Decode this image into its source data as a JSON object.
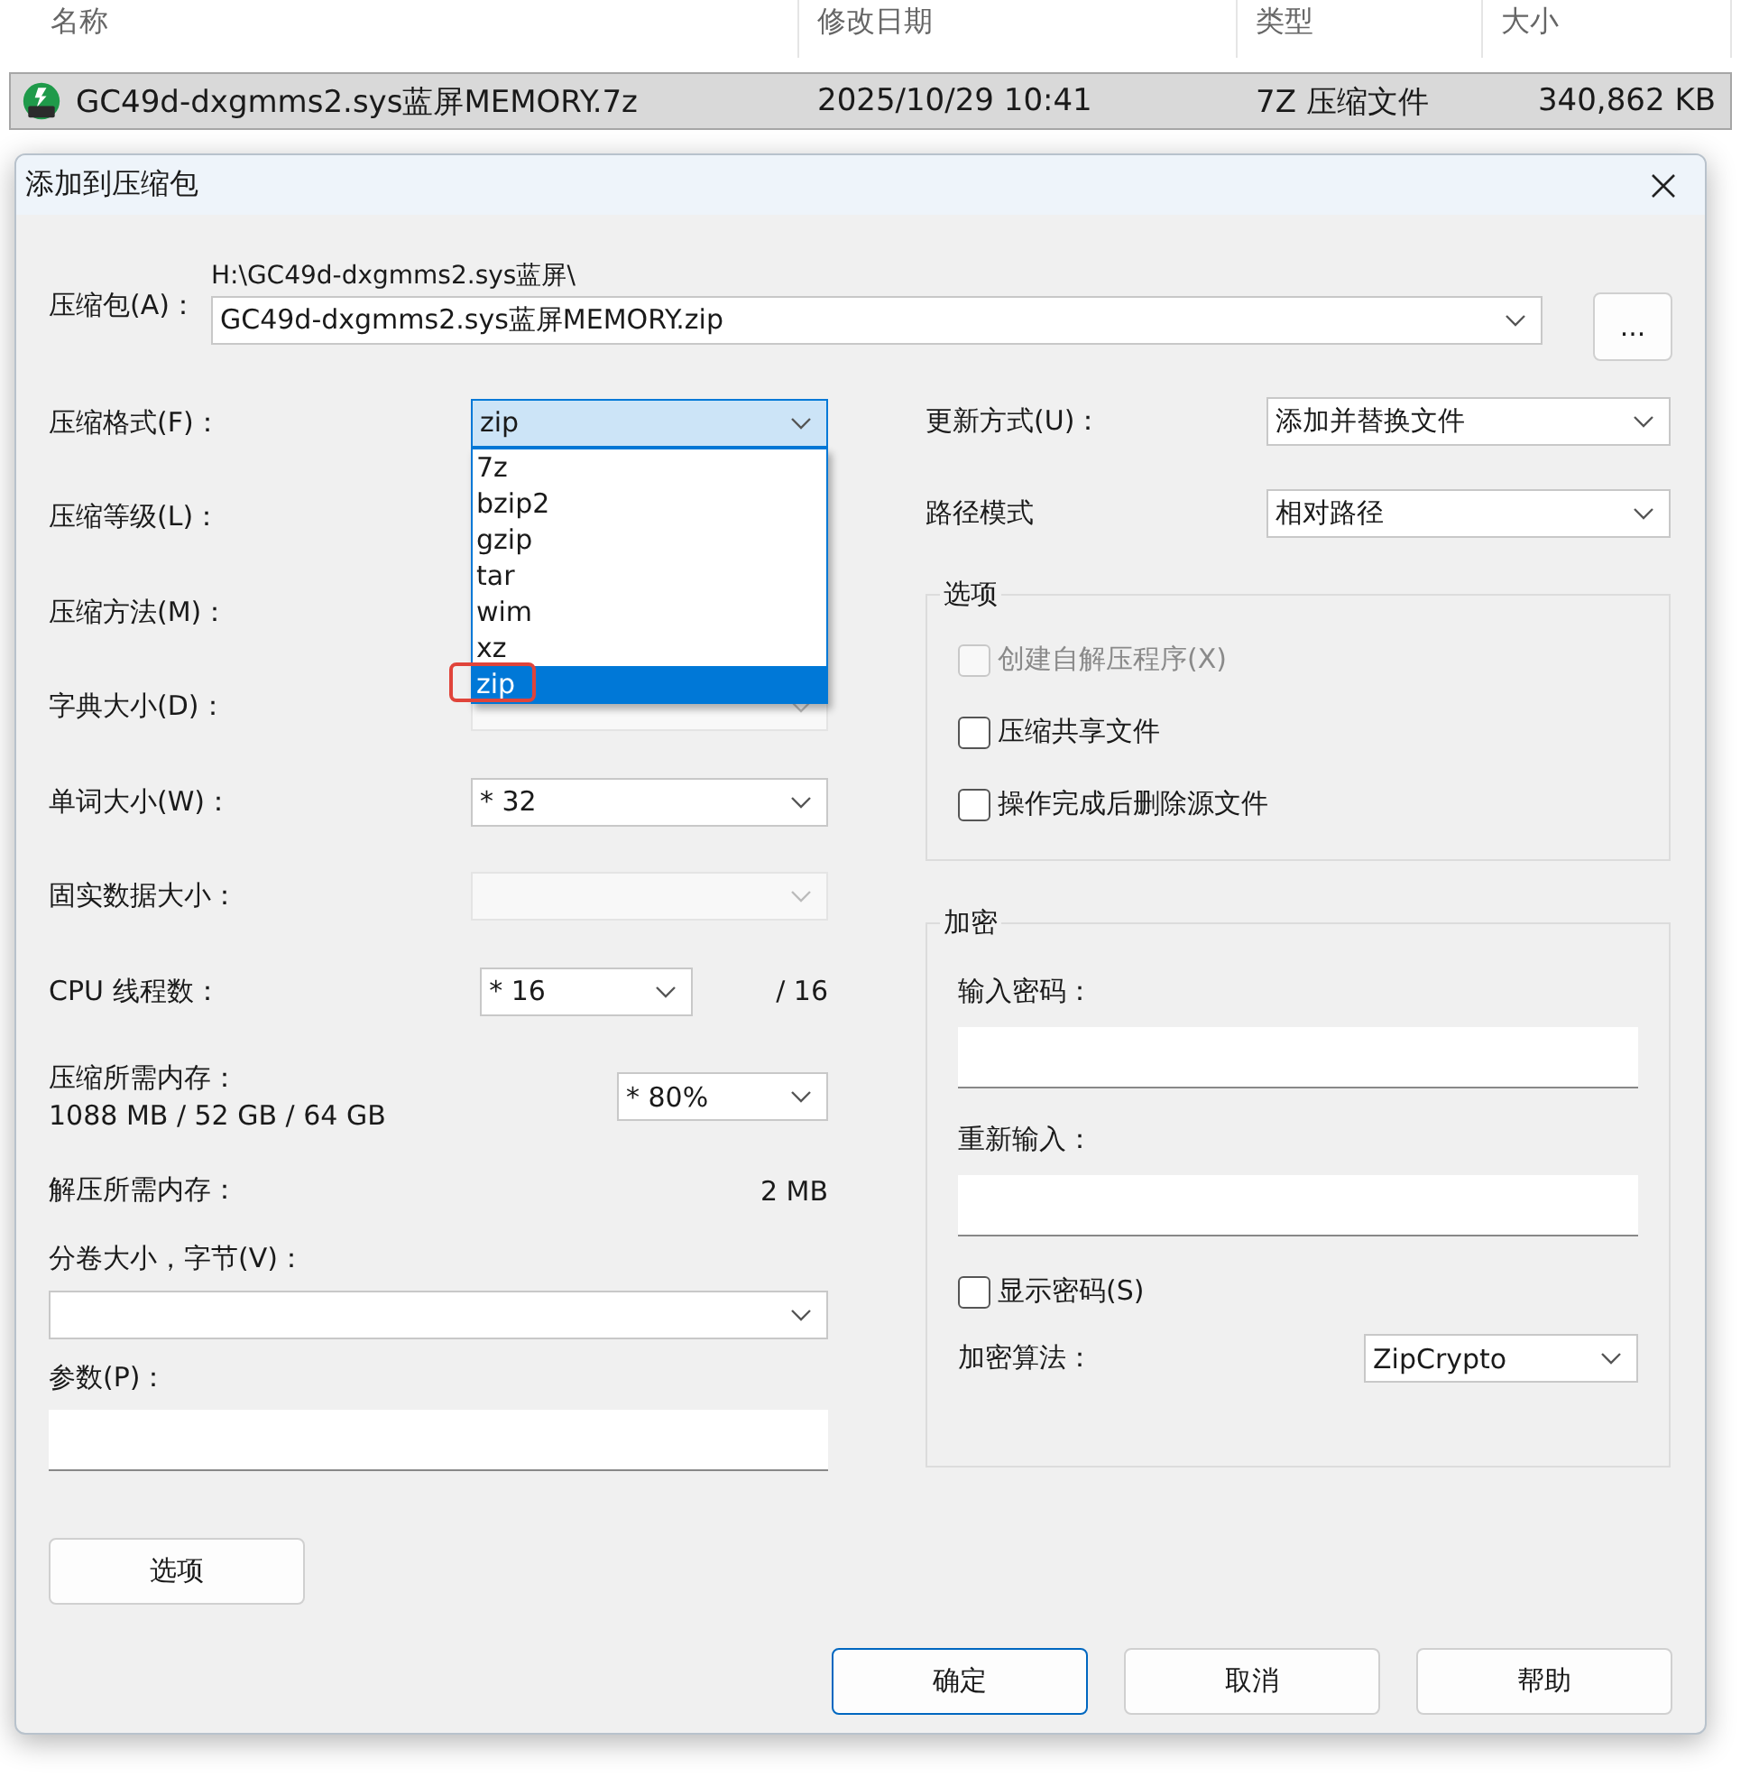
{
  "file_list": {
    "columns": [
      "名称",
      "修改日期",
      "类型",
      "大小"
    ],
    "rows": [
      {
        "name": "GC49d-dxgmms2.sys蓝屏MEMORY.7z",
        "modified": "2025/10/29 10:41",
        "type": "7Z 压缩文件",
        "size": "340,862 KB",
        "selected": true
      }
    ]
  },
  "dialog": {
    "title": "添加到压缩包",
    "archive": {
      "label": "压缩包(A)：",
      "path": "H:\\GC49d-dxgmms2.sys蓝屏\\",
      "value": "GC49d-dxgmms2.sys蓝屏MEMORY.zip",
      "browse": "..."
    },
    "left_rows": [
      {
        "kind": "combo",
        "label": "压缩格式(F)：",
        "value": "zip",
        "disabled": false,
        "expanded": true,
        "options": [
          {
            "label": "7z",
            "selected": false
          },
          {
            "label": "bzip2",
            "selected": false
          },
          {
            "label": "gzip",
            "selected": false
          },
          {
            "label": "tar",
            "selected": false
          },
          {
            "label": "wim",
            "selected": false
          },
          {
            "label": "xz",
            "selected": false
          },
          {
            "label": "zip",
            "selected": true,
            "annotated": true
          }
        ]
      },
      {
        "kind": "label",
        "label": "压缩等级(L)："
      },
      {
        "kind": "label",
        "label": "压缩方法(M)："
      },
      {
        "kind": "combo",
        "label": "字典大小(D)：",
        "disabled": true,
        "expanded": false
      },
      {
        "kind": "combo",
        "label": "单词大小(W)：",
        "value": "* 32",
        "disabled": false,
        "expanded": false
      },
      {
        "kind": "combo",
        "label": "固实数据大小：",
        "disabled": true,
        "expanded": false
      },
      {
        "kind": "count",
        "label": "CPU 线程数：",
        "value": "* 16",
        "total": "/ 16"
      },
      {
        "kind": "memory",
        "label": "压缩所需内存：",
        "detail": "1088 MB / 52 GB / 64 GB",
        "value": "* 80%"
      },
      {
        "kind": "info",
        "label": "解压所需内存：",
        "value": "2 MB"
      },
      {
        "kind": "stacked_combo",
        "label": "分卷大小，字节(V)："
      },
      {
        "kind": "stacked_field",
        "label": "参数(P)："
      }
    ],
    "options_button": "选项",
    "update": {
      "label": "更新方式(U)：",
      "value": "添加并替换文件"
    },
    "path_mode": {
      "label": "路径模式",
      "value": "相对路径"
    },
    "options_group": {
      "title": "选项",
      "checkboxes": [
        {
          "label": "创建自解压程序(X)",
          "checked": false,
          "disabled": true
        },
        {
          "label": "压缩共享文件",
          "checked": false,
          "disabled": false
        },
        {
          "label": "操作完成后删除源文件",
          "checked": false,
          "disabled": false
        }
      ]
    },
    "encryption": {
      "title": "加密",
      "password_label": "输入密码：",
      "repeat_label": "重新输入：",
      "show_password": {
        "label": "显示密码(S)",
        "checked": false
      },
      "method_label": "加密算法：",
      "method": "ZipCrypto"
    },
    "buttons": [
      {
        "label": "确定",
        "default": true
      },
      {
        "label": "取消",
        "default": false
      },
      {
        "label": "帮助",
        "default": false
      }
    ]
  }
}
